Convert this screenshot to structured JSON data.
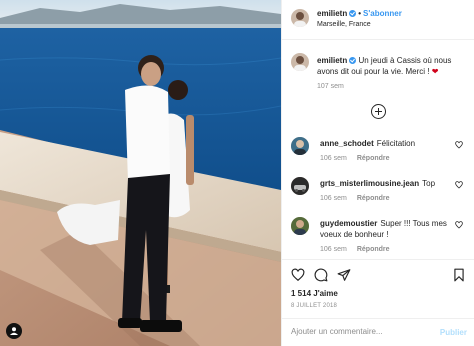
{
  "post": {
    "username": "emilietn",
    "follow_label": "S'abonner",
    "separator": "•",
    "location": "Marseille, France",
    "caption_text": "Un jeudi à Cassis où nous avons dit oui pour la vie. Merci !",
    "caption_emoji": "❤",
    "caption_age": "107 sem"
  },
  "comments": [
    {
      "user": "anne_schodet",
      "text": "Félicitation",
      "age": "106 sem",
      "reply": "Répondre"
    },
    {
      "user": "grts_misterlimousine.jean",
      "text": "Top",
      "age": "106 sem",
      "reply": "Répondre"
    },
    {
      "user": "guydemoustier",
      "text": "Super !!! Tous mes voeux de bonheur !",
      "age": "106 sem",
      "reply": "Répondre"
    }
  ],
  "stats": {
    "likes": "1 514 J'aime",
    "date": "8 JUILLET 2018"
  },
  "composer": {
    "placeholder": "Ajouter un commentaire...",
    "publish_label": "Publier"
  },
  "icons": {
    "verified": "verified-badge-icon",
    "load_more": "plus-circle-icon",
    "like": "heart-outline-icon",
    "comment": "speech-bubble-icon",
    "share": "paper-plane-icon",
    "save": "bookmark-icon",
    "photo_tag": "user-tag-icon"
  },
  "colors": {
    "link_blue": "#3897f0",
    "muted_gray": "#8e8e8e",
    "heart_red": "#d0021b",
    "publish_disabled": "#b2dffc"
  }
}
